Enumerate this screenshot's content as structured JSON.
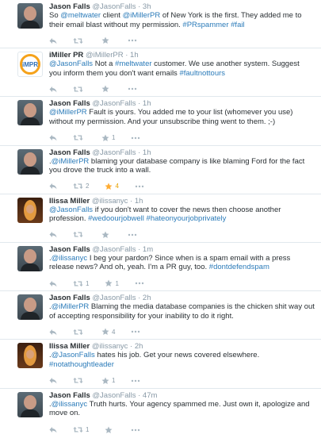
{
  "icons": {
    "reply": "reply-icon",
    "retweet": "retweet-icon",
    "favorite": "star-icon",
    "more": "more-icon"
  },
  "colors": {
    "link": "#2b7bb9",
    "muted": "#8899a6",
    "fav_active": "#ffac33"
  },
  "tweets": [
    {
      "name": "Jason Falls",
      "handle": "@JasonFalls",
      "time": "3h",
      "segments": [
        {
          "t": "So ",
          "link": false
        },
        {
          "t": "@meltwater",
          "link": true
        },
        {
          "t": " client ",
          "link": false
        },
        {
          "t": "@iMillerPR",
          "link": true
        },
        {
          "t": " of New York is the first. They added me to",
          "link": false
        },
        {
          "br": true
        },
        {
          "t": "their email blast without my permission. ",
          "link": false
        },
        {
          "t": "#PRspammer",
          "link": true
        },
        {
          "t": " ",
          "link": false
        },
        {
          "t": "#fail",
          "link": true
        }
      ],
      "retweets": "",
      "favorites": ""
    },
    {
      "name": "iMiller PR",
      "handle": "@iMillerPR",
      "time": "1h",
      "logo_text": "iMPR",
      "segments": [
        {
          "t": "@JasonFalls",
          "link": true
        },
        {
          "t": " Not a ",
          "link": false
        },
        {
          "t": "#meltwater",
          "link": true
        },
        {
          "t": " customer.  We use another system.  Suggest",
          "link": false
        },
        {
          "br": true
        },
        {
          "t": "you inform them you don't want emails ",
          "link": false
        },
        {
          "t": "#faultnottours",
          "link": true
        }
      ],
      "retweets": "",
      "favorites": ""
    },
    {
      "name": "Jason Falls",
      "handle": "@JasonFalls",
      "time": "1h",
      "segments": [
        {
          "t": "@iMillerPR",
          "link": true
        },
        {
          "t": " Fault is yours. You added me to your list (whomever you use)",
          "link": false
        },
        {
          "br": true
        },
        {
          "t": "without my permission. And your unsubscribe thing went to them. ;-)",
          "link": false
        }
      ],
      "retweets": "",
      "favorites": "1"
    },
    {
      "name": "Jason Falls",
      "handle": "@JasonFalls",
      "time": "1h",
      "segments": [
        {
          "t": ".",
          "link": false
        },
        {
          "t": "@iMillerPR",
          "link": true
        },
        {
          "t": " blaming your database company is like blaming Ford for the fact",
          "link": false
        },
        {
          "br": true
        },
        {
          "t": "you drove the truck into a wall.",
          "link": false
        }
      ],
      "retweets": "2",
      "favorites": "4",
      "fav_active": true
    },
    {
      "name": "Ilissa Miller",
      "handle": "@ilissanyc",
      "time": "1h",
      "segments": [
        {
          "t": "@JasonFalls",
          "link": true
        },
        {
          "t": " if you don't want to cover the news then choose another",
          "link": false
        },
        {
          "br": true
        },
        {
          "t": "profession. ",
          "link": false
        },
        {
          "t": "#wedoourjobwell",
          "link": true
        },
        {
          "t": " ",
          "link": false
        },
        {
          "t": "#hateonyourjobprivately",
          "link": true
        }
      ],
      "retweets": "",
      "favorites": ""
    },
    {
      "name": "Jason Falls",
      "handle": "@JasonFalls",
      "time": "1m",
      "segments": [
        {
          "t": ".",
          "link": false
        },
        {
          "t": "@ilissanyc",
          "link": true
        },
        {
          "t": " I beg your pardon? Since when is a spam email with a press",
          "link": false
        },
        {
          "br": true
        },
        {
          "t": "release news? And oh, yeah. I'm a PR guy, too. ",
          "link": false
        },
        {
          "t": "#dontdefendspam",
          "link": true
        }
      ],
      "retweets": "1",
      "favorites": "1"
    },
    {
      "name": "Jason Falls",
      "handle": "@JasonFalls",
      "time": "2h",
      "segments": [
        {
          "t": ".",
          "link": false
        },
        {
          "t": "@iMillerPR",
          "link": true
        },
        {
          "t": " Blaming the media database companies is the chicken shit way out",
          "link": false
        },
        {
          "br": true
        },
        {
          "t": "of accepting responsibility for your inability to do it right.",
          "link": false
        }
      ],
      "retweets": "",
      "favorites": "4"
    },
    {
      "name": "Ilissa Miller",
      "handle": "@ilissanyc",
      "time": "2h",
      "segments": [
        {
          "t": ".",
          "link": false
        },
        {
          "t": "@JasonFalls",
          "link": true
        },
        {
          "t": " hates his job.  Get your news covered elsewhere.",
          "link": false
        },
        {
          "br": true
        },
        {
          "t": "#notathoughtleader",
          "link": true
        }
      ],
      "retweets": "",
      "favorites": "1"
    },
    {
      "name": "Jason Falls",
      "handle": "@JasonFalls",
      "time": "47m",
      "segments": [
        {
          "t": ".",
          "link": false
        },
        {
          "t": "@ilissanyc",
          "link": true
        },
        {
          "t": " Truth hurts. Your agency spammed me. Just own it, apologize and",
          "link": false
        },
        {
          "br": true
        },
        {
          "t": "move on.",
          "link": false
        }
      ],
      "retweets": "1",
      "favorites": ""
    }
  ]
}
